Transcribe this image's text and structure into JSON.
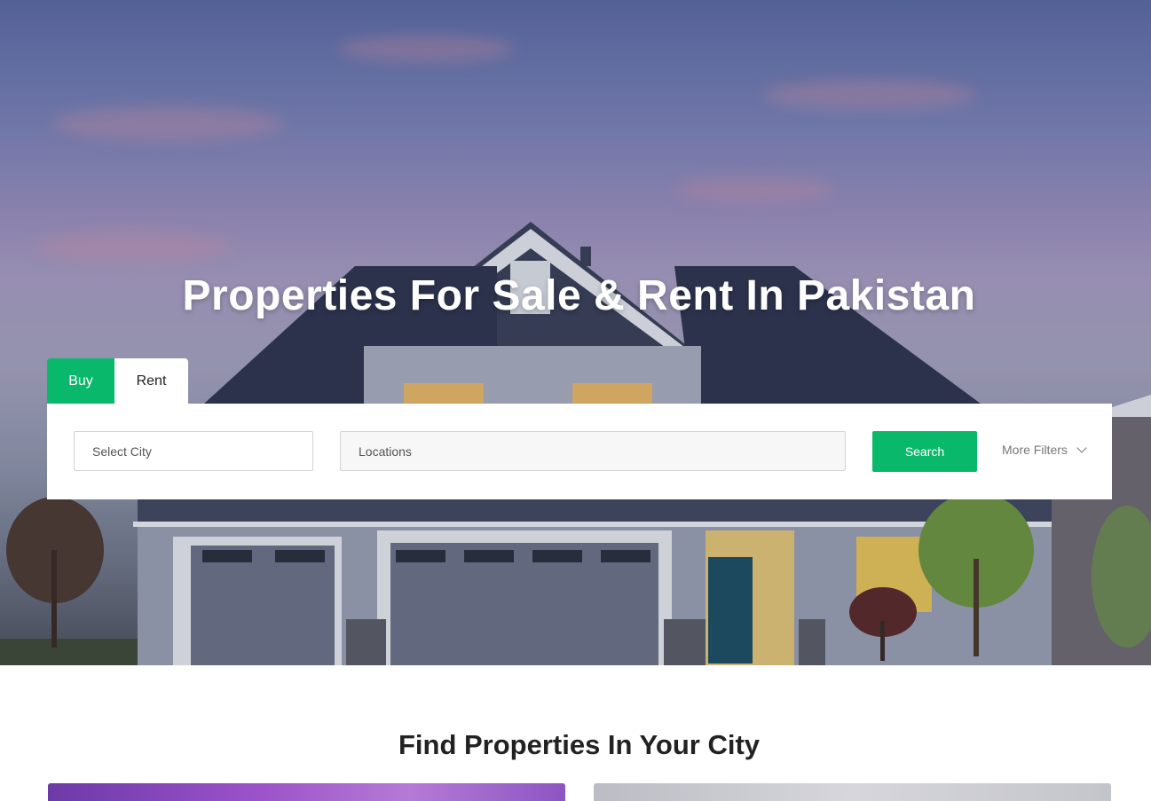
{
  "hero": {
    "title": "Properties For Sale & Rent In Pakistan"
  },
  "tabs": [
    {
      "label": "Buy",
      "active": true
    },
    {
      "label": "Rent",
      "active": false
    }
  ],
  "search": {
    "city_placeholder": "Select City",
    "location_placeholder": "Locations",
    "search_label": "Search",
    "more_filters_label": "More Filters"
  },
  "section": {
    "title": "Find Properties In Your City"
  },
  "colors": {
    "accent": "#0ab86b",
    "text_dark": "#222222",
    "panel_bg": "#ffffff"
  },
  "icons": {
    "more_filters": "chevron-down-icon"
  }
}
